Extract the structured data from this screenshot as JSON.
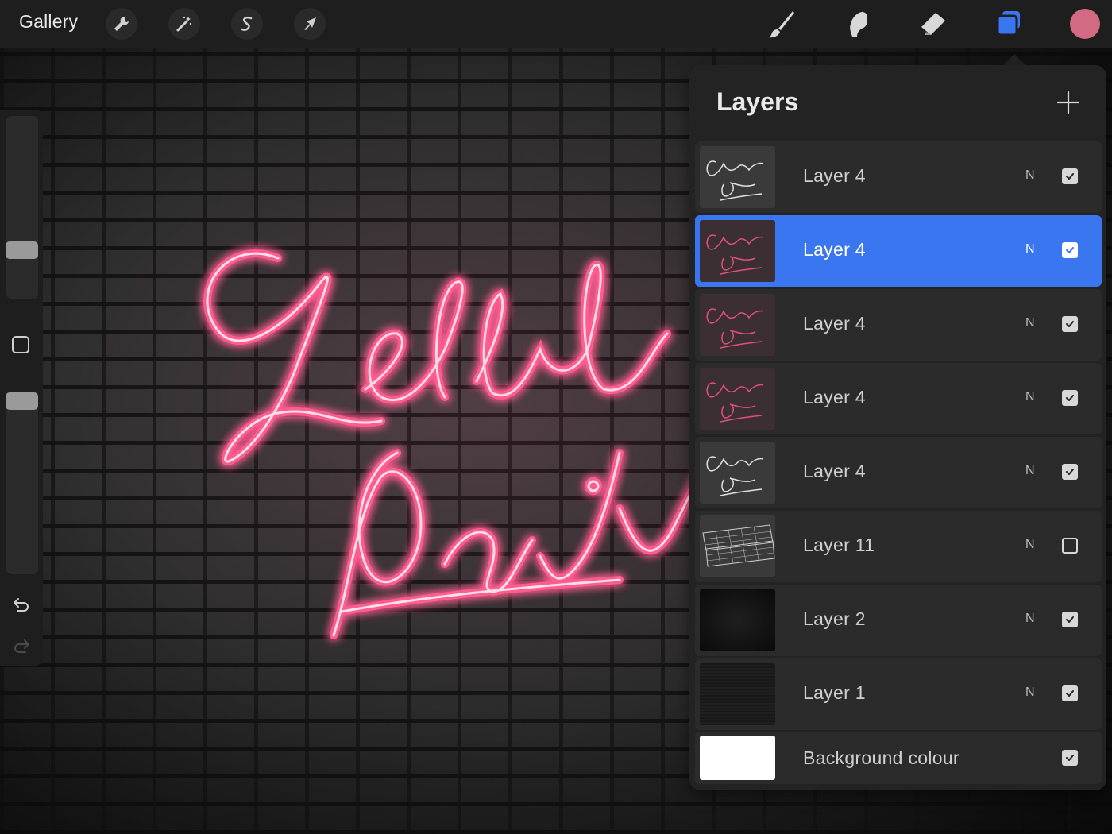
{
  "topbar": {
    "gallery_label": "Gallery",
    "left_tools": [
      {
        "name": "actions",
        "icon": "wrench-icon"
      },
      {
        "name": "adjustments",
        "icon": "magic-wand-icon"
      },
      {
        "name": "selection",
        "icon": "selection-s-icon"
      },
      {
        "name": "transform",
        "icon": "arrow-cursor-icon"
      }
    ],
    "right_tools": [
      {
        "name": "brush",
        "icon": "brush-icon"
      },
      {
        "name": "smudge",
        "icon": "smudge-finger-icon"
      },
      {
        "name": "eraser",
        "icon": "eraser-icon"
      },
      {
        "name": "layers",
        "icon": "layers-icon",
        "active": true
      }
    ],
    "current_color": "#d36a84"
  },
  "sidebar": {
    "brush_size_icon": "slider-icon",
    "opacity_icon": "slider-icon",
    "modify_icon": "square-icon",
    "undo_icon": "undo-icon",
    "redo_icon": "redo-icon"
  },
  "canvas": {
    "artwork_text": [
      "Lettering",
      "Daily"
    ],
    "neon_color": "#ff5c8f"
  },
  "layers_panel": {
    "title": "Layers",
    "add_icon": "plus-icon",
    "layers": [
      {
        "name": "Layer 4",
        "blend": "N",
        "visible": true,
        "active": false,
        "thumb": "lettering-white"
      },
      {
        "name": "Layer 4",
        "blend": "N",
        "visible": true,
        "active": true,
        "thumb": "lettering-pink"
      },
      {
        "name": "Layer 4",
        "blend": "N",
        "visible": true,
        "active": false,
        "thumb": "lettering-pink"
      },
      {
        "name": "Layer 4",
        "blend": "N",
        "visible": true,
        "active": false,
        "thumb": "lettering-pink"
      },
      {
        "name": "Layer 4",
        "blend": "N",
        "visible": true,
        "active": false,
        "thumb": "lettering-white"
      },
      {
        "name": "Layer 11",
        "blend": "N",
        "visible": false,
        "active": false,
        "thumb": "grid"
      },
      {
        "name": "Layer 2",
        "blend": "N",
        "visible": true,
        "active": false,
        "thumb": "dark"
      },
      {
        "name": "Layer 1",
        "blend": "N",
        "visible": true,
        "active": false,
        "thumb": "texture"
      }
    ],
    "background": {
      "name": "Background colour",
      "visible": true,
      "color": "#ffffff"
    }
  }
}
